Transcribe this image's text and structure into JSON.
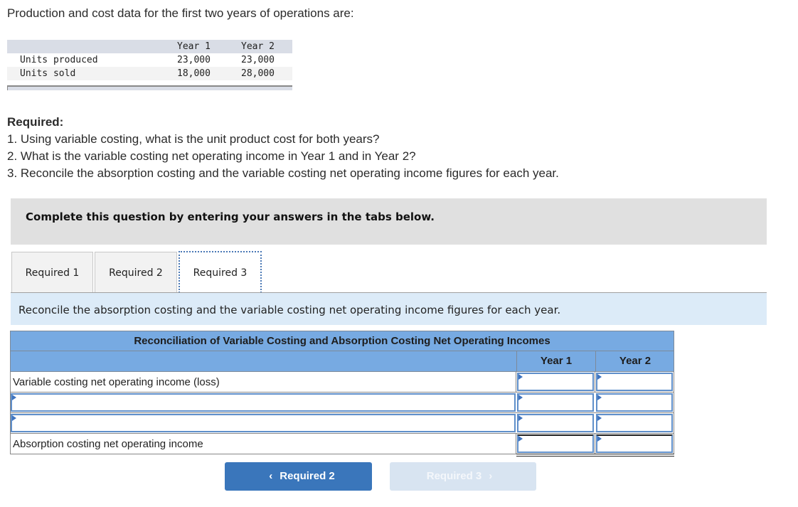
{
  "intro": "Production and cost data for the first two years of operations are:",
  "data_table": {
    "headers": [
      "",
      "Year 1",
      "Year 2"
    ],
    "rows": [
      {
        "label": "Units produced",
        "year1": "23,000",
        "year2": "23,000"
      },
      {
        "label": "Units sold",
        "year1": "18,000",
        "year2": "28,000"
      }
    ]
  },
  "required": {
    "title": "Required:",
    "items": [
      "1. Using variable costing, what is the unit product cost for both years?",
      "2. What is the variable costing net operating income in Year 1 and in Year 2?",
      "3. Reconcile the absorption costing and the variable costing net operating income figures for each year."
    ]
  },
  "instruction": "Complete this question by entering your answers in the tabs below.",
  "tabs": [
    {
      "label": "Required 1",
      "active": false
    },
    {
      "label": "Required 2",
      "active": false
    },
    {
      "label": "Required 3",
      "active": true
    }
  ],
  "prompt": "Reconcile the absorption costing and the variable costing net operating income figures for each year.",
  "reconciliation": {
    "title": "Reconciliation of Variable Costing and Absorption Costing Net Operating Incomes",
    "columns": [
      "Year 1",
      "Year 2"
    ],
    "rows": [
      {
        "label": "Variable costing net operating income (loss)",
        "type": "static",
        "year1": "",
        "year2": ""
      },
      {
        "label": "",
        "type": "input",
        "year1": "",
        "year2": ""
      },
      {
        "label": "",
        "type": "input",
        "year1": "",
        "year2": ""
      },
      {
        "label": "Absorption costing net operating income",
        "type": "total",
        "year1": "",
        "year2": ""
      }
    ]
  },
  "nav": {
    "prev_label": "Required 2",
    "next_label": "Required 3",
    "prev_icon": "‹",
    "next_icon": "›",
    "next_disabled": true
  },
  "colors": {
    "table_header": "#77aae2",
    "prompt_bg": "#dcebf8",
    "button_primary": "#3a76bb",
    "button_disabled": "#d8e4f1"
  }
}
